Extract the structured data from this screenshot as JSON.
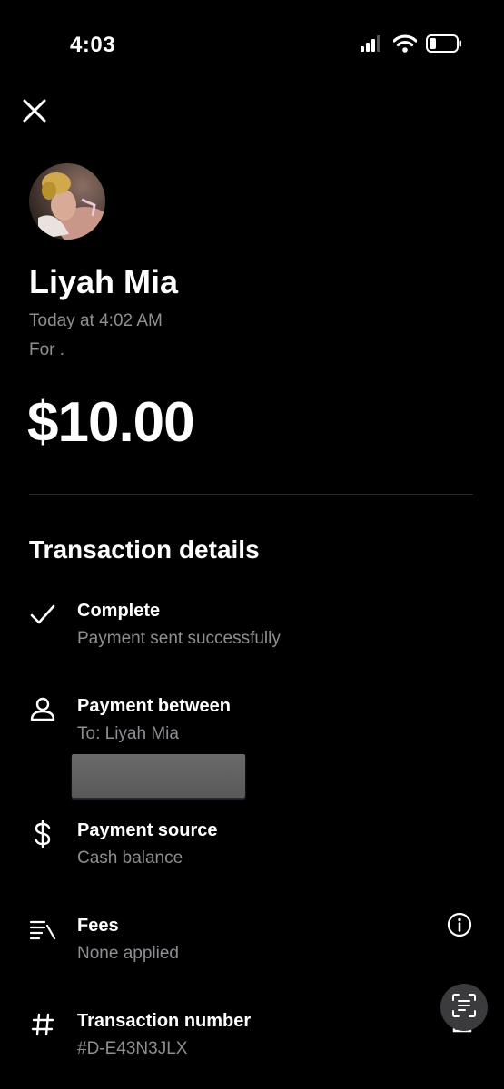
{
  "status_bar": {
    "time": "4:03"
  },
  "recipient": {
    "name": "Liyah Mia",
    "date": "Today at 4:02 AM",
    "note": "For ."
  },
  "amount": "$10.00",
  "details": {
    "title": "Transaction details",
    "items": [
      {
        "icon": "checkmark-icon",
        "title": "Complete",
        "subtitle": "Payment sent successfully"
      },
      {
        "icon": "person-icon",
        "title": "Payment between",
        "subtitle": "To: Liyah Mia"
      },
      {
        "icon": "dollar-icon",
        "title": "Payment source",
        "subtitle": "Cash balance"
      },
      {
        "icon": "fees-icon",
        "title": "Fees",
        "subtitle": "None applied"
      },
      {
        "icon": "hash-icon",
        "title": "Transaction number",
        "subtitle": "#D-E43N3JLX"
      }
    ]
  },
  "colors": {
    "background": "#000000",
    "primary_text": "#ffffff",
    "secondary_text": "#8e8e93",
    "divider": "#2a2a2a"
  }
}
